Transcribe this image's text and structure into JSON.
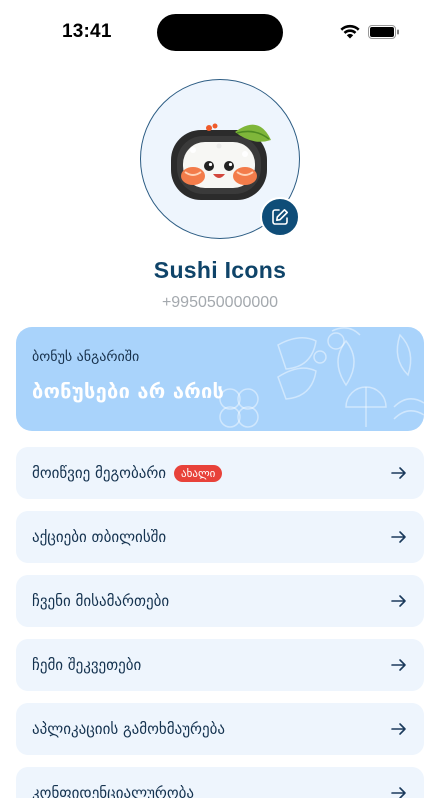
{
  "status_bar": {
    "time": "13:41",
    "wifi_icon": "wifi-icon",
    "battery_icon": "battery-icon"
  },
  "profile": {
    "name": "Sushi Icons",
    "phone": "+995050000000",
    "avatar_icon": "sushi-roll-icon",
    "edit_icon": "edit-icon"
  },
  "bonus": {
    "title": "ბონუს ანგარიში",
    "value": "ბონუსები არ არის"
  },
  "menu": {
    "items": [
      {
        "label": "მოიწვიე მეგობარი",
        "badge": "ახალი"
      },
      {
        "label": "აქციები თბილისში"
      },
      {
        "label": "ჩვენი მისამართები"
      },
      {
        "label": "ჩემი შეკვეთები"
      },
      {
        "label": "აპლიკაციის გამოხმაურება"
      },
      {
        "label": "კონფიდენციალურობა"
      }
    ],
    "arrow_icon": "arrow-right-icon"
  },
  "colors": {
    "accent": "#0f4d78",
    "card_bg": "#eef5fd",
    "bonus_bg": "#a9d3fb",
    "badge": "#e8423a"
  }
}
